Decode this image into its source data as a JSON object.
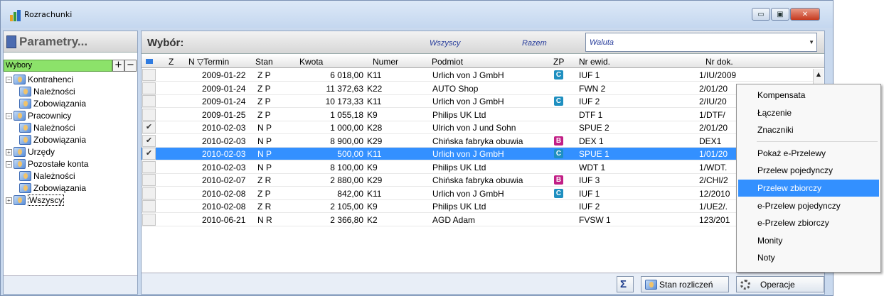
{
  "window": {
    "title": "Rozrachunki",
    "buttons": [
      "▭",
      "▣",
      "✕"
    ]
  },
  "left": {
    "param_label": "Parametry...",
    "wybory_label": "Wybory",
    "plus": "+",
    "minus": "−",
    "tree": [
      {
        "label": "Kontrahenci",
        "level": 0,
        "exp": "−"
      },
      {
        "label": "Należności",
        "level": 1
      },
      {
        "label": "Zobowiązania",
        "level": 1
      },
      {
        "label": "Pracownicy",
        "level": 0,
        "exp": "−"
      },
      {
        "label": "Należności",
        "level": 1
      },
      {
        "label": "Zobowiązania",
        "level": 1
      },
      {
        "label": "Urzędy",
        "level": 0,
        "exp": "+"
      },
      {
        "label": "Pozostałe konta",
        "level": 0,
        "exp": "−"
      },
      {
        "label": "Należności",
        "level": 1
      },
      {
        "label": "Zobowiązania",
        "level": 1
      },
      {
        "label": "Wszyscy",
        "level": 0,
        "exp": "+",
        "selected": true
      }
    ]
  },
  "topbar": {
    "wybor": "Wybór:",
    "wszyscy": "Wszyscy",
    "razem": "Razem",
    "waluta": "Waluta"
  },
  "grid": {
    "headers": {
      "z": "Z",
      "n": "N",
      "termin": "▽Termin",
      "stan": "Stan",
      "kwota": "Kwota",
      "numer": "Numer",
      "podmiot": "Podmiot",
      "zp": "ZP",
      "nrewid": "Nr ewid.",
      "nrdok": "Nr dok."
    },
    "rows": [
      {
        "check": "",
        "termin": "2009-01-22",
        "stan": "Z P",
        "kwota": "6 018,00",
        "numer": "K11",
        "podmiot": "Urlich von J GmbH",
        "zp": "C",
        "nrewid": "IUF  1",
        "nrdok": "1/IU/2009"
      },
      {
        "check": "",
        "termin": "2009-01-24",
        "stan": "Z P",
        "kwota": "11 372,63",
        "numer": "K22",
        "podmiot": "AUTO Shop",
        "zp": "",
        "nrewid": "FWN  2",
        "nrdok": "2/01/20"
      },
      {
        "check": "",
        "termin": "2009-01-24",
        "stan": "Z P",
        "kwota": "10 173,33",
        "numer": "K11",
        "podmiot": "Urlich von J GmbH",
        "zp": "C",
        "nrewid": "IUF  2",
        "nrdok": "2/IU/20"
      },
      {
        "check": "",
        "termin": "2009-01-25",
        "stan": "Z P",
        "kwota": "1 055,18",
        "numer": "K9",
        "podmiot": "Philips UK Ltd",
        "zp": "",
        "nrewid": "DTF  1",
        "nrdok": "1/DTF/"
      },
      {
        "check": "✔",
        "termin": "2010-02-03",
        "stan": "N P",
        "kwota": "1 000,00",
        "numer": "K28",
        "podmiot": "Ulrich von J und Sohn",
        "zp": "",
        "nrewid": "SPUE  2",
        "nrdok": "2/01/20"
      },
      {
        "check": "✔",
        "termin": "2010-02-03",
        "stan": "N P",
        "kwota": "8 900,00",
        "numer": "K29",
        "podmiot": "Chińska fabryka obuwia",
        "zp": "B",
        "nrewid": "DEX  1",
        "nrdok": "DEX1"
      },
      {
        "check": "✔",
        "termin": "2010-02-03",
        "stan": "N P",
        "kwota": "500,00",
        "numer": "K11",
        "podmiot": "Urlich von J GmbH",
        "zp": "C",
        "nrewid": "SPUE  1",
        "nrdok": "1/01/20",
        "selected": true
      },
      {
        "check": "",
        "termin": "2010-02-03",
        "stan": "N P",
        "kwota": "8 100,00",
        "numer": "K9",
        "podmiot": "Philips UK Ltd",
        "zp": "",
        "nrewid": "WDT  1",
        "nrdok": "1/WDT."
      },
      {
        "check": "",
        "termin": "2010-02-07",
        "stan": "Z R",
        "kwota": "2 880,00",
        "numer": "K29",
        "podmiot": "Chińska fabryka obuwia",
        "zp": "B",
        "nrewid": "IUF  3",
        "nrdok": "2/CHI/2"
      },
      {
        "check": "",
        "termin": "2010-02-08",
        "stan": "Z P",
        "kwota": "842,00",
        "numer": "K11",
        "podmiot": "Urlich von J GmbH",
        "zp": "C",
        "nrewid": "IUF  1",
        "nrdok": "12/2010"
      },
      {
        "check": "",
        "termin": "2010-02-08",
        "stan": "Z R",
        "kwota": "2 105,00",
        "numer": "K9",
        "podmiot": "Philips UK Ltd",
        "zp": "",
        "nrewid": "IUF  2",
        "nrdok": "1/UE2/."
      },
      {
        "check": "",
        "termin": "2010-06-21",
        "stan": "N R",
        "kwota": "2 366,80",
        "numer": "K2",
        "podmiot": "AGD Adam",
        "zp": "",
        "nrewid": "FVSW  1",
        "nrdok": "123/201"
      }
    ]
  },
  "footer": {
    "sigma": "Σ",
    "stan_rozliczen": "Stan rozliczeń",
    "operacje": "Operacje"
  },
  "menu": {
    "items": [
      {
        "label": "Kompensata"
      },
      {
        "label": "Łączenie"
      },
      {
        "label": "Znaczniki"
      },
      {
        "label": "Pokaż e-Przelewy",
        "sep_before": true
      },
      {
        "label": "Przelew pojedynczy"
      },
      {
        "label": "Przelew zbiorczy",
        "highlight": true
      },
      {
        "label": "e-Przelew pojedynczy"
      },
      {
        "label": "e-Przelew zbiorczy"
      },
      {
        "label": "Monity"
      },
      {
        "label": "Noty"
      }
    ]
  }
}
